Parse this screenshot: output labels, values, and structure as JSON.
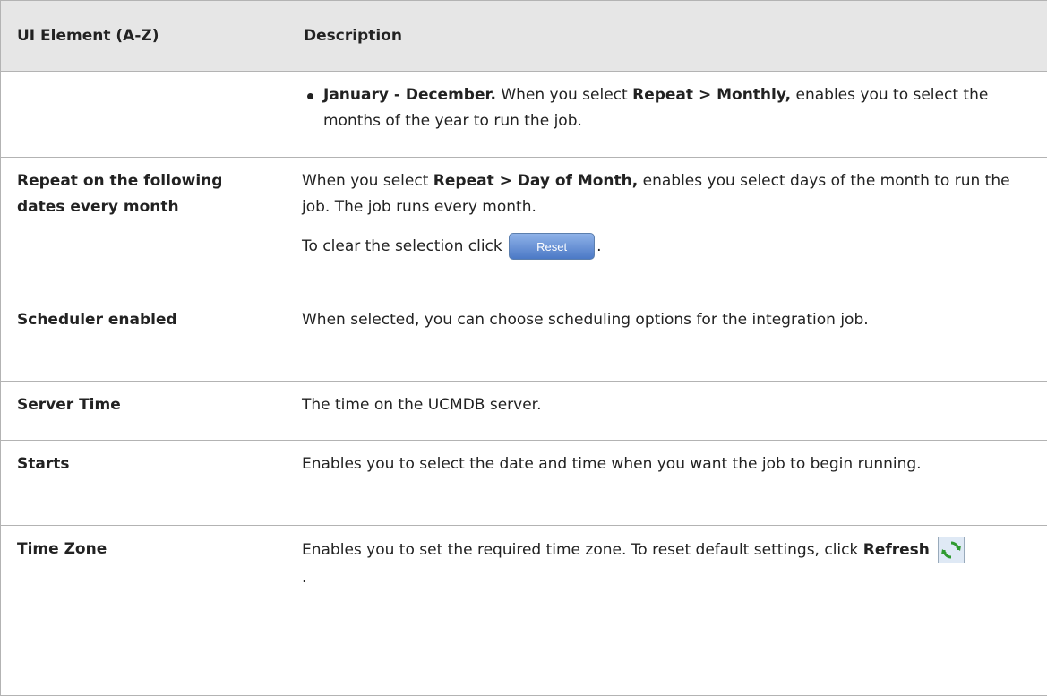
{
  "table": {
    "header": {
      "col1": "UI Element (A-Z)",
      "col2": "Description"
    },
    "row1": {
      "bullet_bold": "January - December.",
      "text_a": " When you select ",
      "bold_b": "Repeat > Monthly,",
      "text_c": " enables you to select the months of the year to run the job."
    },
    "row2": {
      "element": "Repeat on the following dates every month",
      "p1_a": "When you select ",
      "p1_bold": "Repeat > Day of Month,",
      "p1_b": " enables you select days of the month to run the job. The job runs every month.",
      "p2_a": "To clear the selection click",
      "reset_label": "Reset",
      "p2_end": "."
    },
    "row3": {
      "element": "Scheduler enabled",
      "description": "When selected, you can choose scheduling options for the integration job."
    },
    "row4": {
      "element": "Server Time",
      "description": "The time on the UCMDB server."
    },
    "row5": {
      "element": "Starts",
      "description": "Enables you to select the date and time when you want the job to begin running."
    },
    "row6": {
      "element": "Time Zone",
      "desc_a": "Enables you to set the required time zone. To reset default settings, click ",
      "desc_bold": "Refresh",
      "desc_end": "."
    }
  },
  "icons": {
    "reset": "reset-button-icon",
    "refresh": "refresh-icon"
  }
}
